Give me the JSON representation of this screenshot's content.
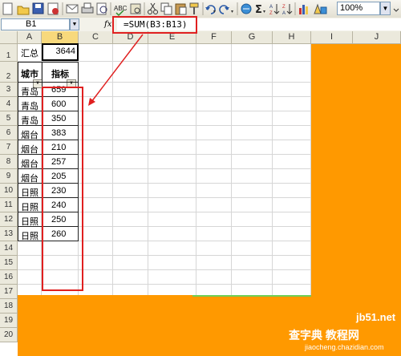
{
  "toolbar": {
    "zoom_value": "100%",
    "icons": [
      "new-icon",
      "open-icon",
      "save-icon",
      "permission-icon",
      "email-icon",
      "print-icon",
      "print-preview-icon",
      "spelling-icon",
      "research-icon",
      "cut-icon",
      "copy-icon",
      "paste-icon",
      "format-painter-icon",
      "undo-icon",
      "redo-icon",
      "hyperlink-icon",
      "autosum-icon",
      "sort-ascending-icon",
      "sort-descending-icon",
      "chart-wizard-icon",
      "drawing-icon"
    ],
    "sigma": "Σ"
  },
  "formula_bar": {
    "name_box": "B1",
    "fx_label": "fx",
    "formula": "=SUM(B3:B13)"
  },
  "columns": [
    "A",
    "B",
    "C",
    "D",
    "E",
    "F",
    "G",
    "H",
    "I",
    "J"
  ],
  "rows": [
    "1",
    "2",
    "3",
    "4",
    "5",
    "6",
    "7",
    "8",
    "9",
    "10",
    "11",
    "12",
    "13",
    "14",
    "15",
    "16",
    "17",
    "18",
    "19",
    "20"
  ],
  "cells": {
    "A1": "汇总",
    "B1": "3644",
    "A2": "城市",
    "B2": "指标"
  },
  "table": [
    {
      "city": "青岛",
      "value": "659"
    },
    {
      "city": "青岛",
      "value": "600"
    },
    {
      "city": "青岛",
      "value": "350"
    },
    {
      "city": "烟台",
      "value": "383"
    },
    {
      "city": "烟台",
      "value": "210"
    },
    {
      "city": "烟台",
      "value": "257"
    },
    {
      "city": "烟台",
      "value": "205"
    },
    {
      "city": "日照",
      "value": "230"
    },
    {
      "city": "日照",
      "value": "240"
    },
    {
      "city": "日照",
      "value": "250"
    },
    {
      "city": "日照",
      "value": "260"
    }
  ],
  "colors": {
    "annotation_red": "#e02020",
    "orange_fill": "#ff9900"
  },
  "watermark": {
    "line1": "jb51.net",
    "line2": "查字典 教程网",
    "line3": "jiaocheng.chazidian.com"
  }
}
